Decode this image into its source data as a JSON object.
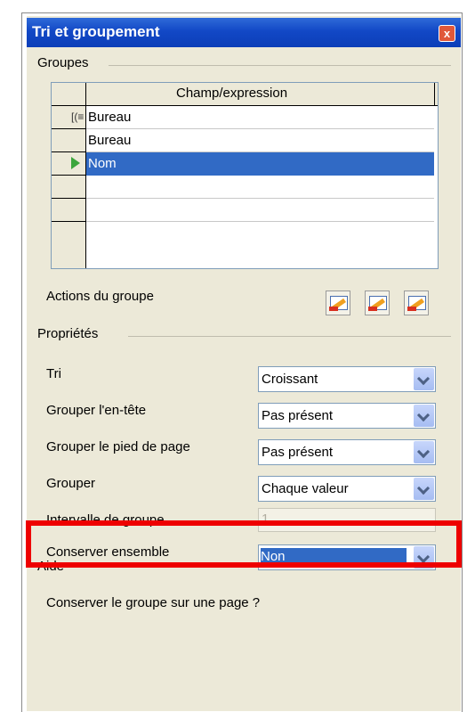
{
  "window": {
    "title": "Tri et groupement",
    "close_label": "x"
  },
  "groups": {
    "legend": "Groupes",
    "column_header": "Champ/expression",
    "rows": [
      "Bureau",
      "Bureau",
      "Nom",
      "",
      "",
      ""
    ],
    "selected_index": 2
  },
  "group_actions": {
    "label": "Actions du groupe"
  },
  "properties": {
    "legend": "Propriétés",
    "tri": {
      "label": "Tri",
      "value": "Croissant"
    },
    "header": {
      "label": "Grouper l'en-tête",
      "value": "Pas présent"
    },
    "footer": {
      "label": "Grouper le pied de page",
      "value": "Pas présent"
    },
    "grouper": {
      "label": "Grouper",
      "value": "Chaque valeur"
    },
    "interval": {
      "label": "Intervalle de groupe",
      "value": "1"
    },
    "keep": {
      "label": "Conserver ensemble",
      "value": "Non"
    }
  },
  "help": {
    "legend": "Aide",
    "text": "Conserver le groupe sur une page ?"
  },
  "colors": {
    "titlebar": "#1248c6",
    "selection": "#316ac5",
    "highlight": "#ee0000"
  },
  "icons": [
    "group-header-icon",
    "current-row-arrow-icon",
    "move-up-icon",
    "move-down-icon",
    "delete-group-icon",
    "chevron-down-icon"
  ]
}
